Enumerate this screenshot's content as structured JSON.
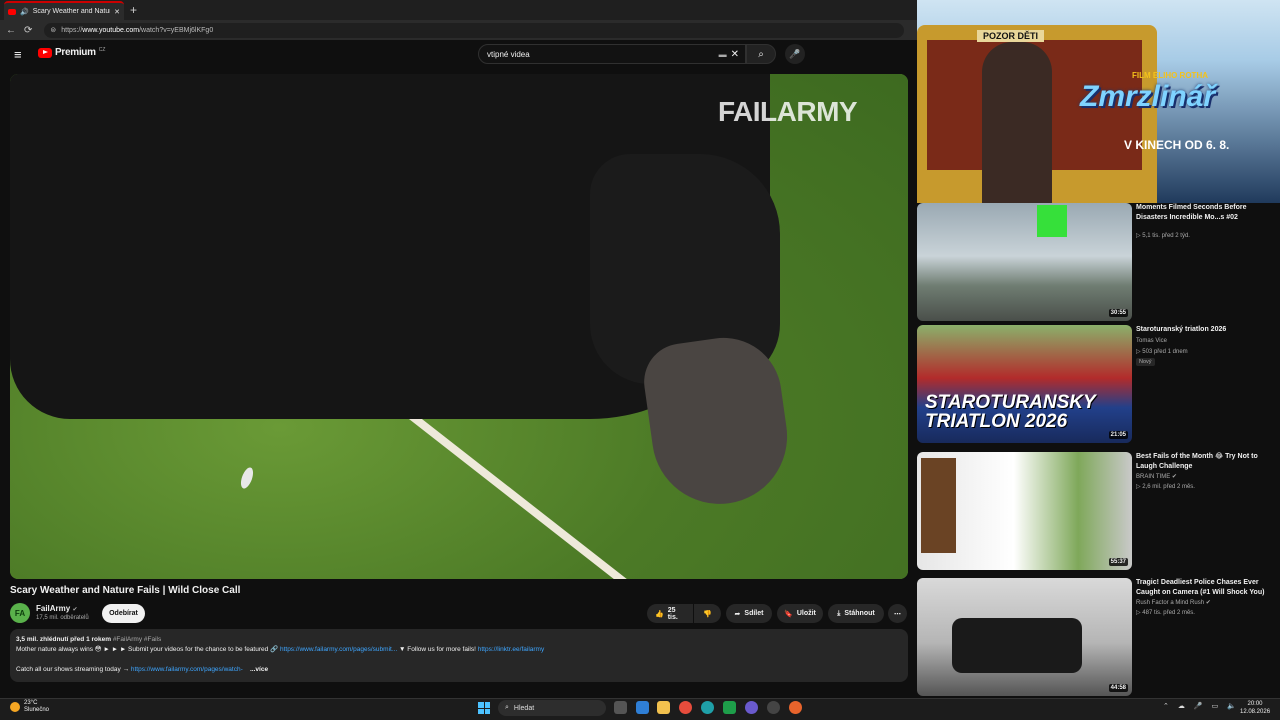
{
  "browser": {
    "tab_title": "Scary Weather and Nature Fa",
    "new_tab_icon": "+",
    "url_prefix": "https://",
    "url_host": "www.youtube.com",
    "url_path": "/watch?v=yEBMj6lKFg0"
  },
  "header": {
    "logo_text": "Premium",
    "logo_region": "CZ",
    "search_value": "vtipné videa"
  },
  "video": {
    "watermark": "FAILARMY",
    "title": "Scary Weather and Nature Fails | Wild Close Call",
    "channel": "FailArmy",
    "channel_initials": "FA",
    "subscribers": "17,5 mil. odběratelů",
    "subscribe_label": "Odebírat",
    "likes": "25 tis.",
    "share_label": "Sdílet",
    "save_label": "Uložit",
    "download_label": "Stáhnout"
  },
  "description": {
    "meta": "3,5 mil. zhlédnutí  před 1 rokem",
    "tags": "#FailArmy #Fails",
    "line1_text": "Mother nature always wins 😳 ► ► ► Submit your videos for the chance to be featured 🔗 ",
    "line1_link": "https://www.failarmy.com/pages/submit...",
    "line1_text2": " ▼ Follow us for more fails! ",
    "line1_link2": "https://linktr.ee/failarmy",
    "line2_text": "Catch all our shows streaming today → ",
    "line2_link": "https://www.failarmy.com/pages/watch-",
    "more_label": "...více"
  },
  "ad": {
    "sign": "POZOR DĚTI",
    "film_of": "FILM ELIHO ROTHA",
    "brand": "Zmrzlinář",
    "date": "V KINECH OD 6. 8."
  },
  "recommendations": [
    {
      "title": "Moments Filmed Seconds Before Disasters   Incredible Mo...s #02",
      "channel": "",
      "meta": "▷ 5,1 tis.   před 2 týd.",
      "duration": "30:55",
      "badge": ""
    },
    {
      "title": "Staroturanský triatlon 2026",
      "channel": "Tomas Vice",
      "meta": "▷ 503   před 1 dnem",
      "duration": "21:05",
      "badge": "Nový"
    },
    {
      "title": "Best Fails of the Month 😂 Try Not to Laugh Challenge",
      "channel": "BRAIN TIME",
      "meta": "▷ 2,6 mil.   před 2 měs.",
      "duration": "55:37",
      "badge": ""
    },
    {
      "title": "Tragic! Deadliest Police Chases Ever Caught on Camera (#1 Will Shock You)",
      "channel": "Rush Factor a Mind Rush",
      "meta": "▷ 487 tis.   před 2 měs.",
      "duration": "44:58",
      "badge": ""
    }
  ],
  "thumb2_text": "STAROTURANSKY TRIATLON 2026",
  "taskbar": {
    "temperature": "23°C",
    "weather": "Slunečno",
    "search_label": "Hledat",
    "time": "20:00",
    "date": "12.08.2026"
  },
  "colors": {
    "accent": "#ff0000",
    "link": "#3ea6ff",
    "background": "#0f0f0f"
  }
}
